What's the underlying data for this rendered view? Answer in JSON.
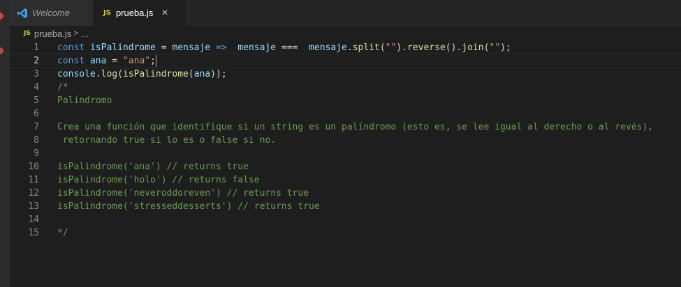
{
  "tabs": [
    {
      "label": "Welcome",
      "icon": "vscode-icon",
      "active": false
    },
    {
      "label": "prueba.js",
      "icon": "js-file-icon",
      "active": true,
      "close": "×"
    }
  ],
  "breadcrumb": {
    "file_icon_text": "JS",
    "file": "prueba.js",
    "separator": ">",
    "more": "..."
  },
  "lines": [
    {
      "num": "1",
      "tokens": [
        {
          "t": "const",
          "c": "kw"
        },
        {
          "t": " ",
          "c": "punc"
        },
        {
          "t": "isPalindrome",
          "c": "var"
        },
        {
          "t": " = ",
          "c": "punc"
        },
        {
          "t": "mensaje",
          "c": "var"
        },
        {
          "t": " ",
          "c": "punc"
        },
        {
          "t": "=>",
          "c": "kw"
        },
        {
          "t": "  ",
          "c": "punc"
        },
        {
          "t": "mensaje",
          "c": "var"
        },
        {
          "t": " ===  ",
          "c": "punc"
        },
        {
          "t": "mensaje",
          "c": "var"
        },
        {
          "t": ".",
          "c": "punc"
        },
        {
          "t": "split",
          "c": "fn"
        },
        {
          "t": "(",
          "c": "punc"
        },
        {
          "t": "\"\"",
          "c": "str"
        },
        {
          "t": ").",
          "c": "punc"
        },
        {
          "t": "reverse",
          "c": "fn"
        },
        {
          "t": "().",
          "c": "punc"
        },
        {
          "t": "join",
          "c": "fn"
        },
        {
          "t": "(",
          "c": "punc"
        },
        {
          "t": "\"\"",
          "c": "str"
        },
        {
          "t": ");",
          "c": "punc"
        }
      ]
    },
    {
      "num": "2",
      "current": true,
      "tokens": [
        {
          "t": "const",
          "c": "kw"
        },
        {
          "t": " ",
          "c": "punc"
        },
        {
          "t": "ana",
          "c": "var"
        },
        {
          "t": " = ",
          "c": "punc"
        },
        {
          "t": "\"ana\"",
          "c": "str"
        },
        {
          "t": ";",
          "c": "punc"
        }
      ]
    },
    {
      "num": "3",
      "tokens": [
        {
          "t": "console",
          "c": "var"
        },
        {
          "t": ".",
          "c": "punc"
        },
        {
          "t": "log",
          "c": "fn"
        },
        {
          "t": "(",
          "c": "punc"
        },
        {
          "t": "isPalindrome",
          "c": "fn"
        },
        {
          "t": "(",
          "c": "punc"
        },
        {
          "t": "ana",
          "c": "var"
        },
        {
          "t": "));",
          "c": "punc"
        }
      ]
    },
    {
      "num": "4",
      "tokens": [
        {
          "t": "/*",
          "c": "cm"
        }
      ]
    },
    {
      "num": "5",
      "tokens": [
        {
          "t": "Palíndromo",
          "c": "cm"
        }
      ]
    },
    {
      "num": "6",
      "tokens": []
    },
    {
      "num": "7",
      "tokens": [
        {
          "t": "Crea una función que identifique si un string es un palíndromo (esto es, se lee igual al derecho o al revés),",
          "c": "cm"
        }
      ]
    },
    {
      "num": "8",
      "tokens": [
        {
          "t": " retornando true si lo es o false si no.",
          "c": "cm"
        }
      ]
    },
    {
      "num": "9",
      "tokens": []
    },
    {
      "num": "10",
      "tokens": [
        {
          "t": "isPalindrome('ana') // returns true",
          "c": "cm"
        }
      ]
    },
    {
      "num": "11",
      "tokens": [
        {
          "t": "isPalindrome('holo') // returns false",
          "c": "cm"
        }
      ]
    },
    {
      "num": "12",
      "tokens": [
        {
          "t": "isPalindrome('neveroddoreven') // returns true",
          "c": "cm"
        }
      ]
    },
    {
      "num": "13",
      "tokens": [
        {
          "t": "isPalindrome('stresseddesserts') // returns true",
          "c": "cm"
        }
      ]
    },
    {
      "num": "14",
      "tokens": []
    },
    {
      "num": "15",
      "tokens": [
        {
          "t": "*/",
          "c": "cm"
        }
      ]
    }
  ],
  "colors": {
    "background": "#1e1e1e",
    "keyword": "#569cd6",
    "variable": "#9cdcfe",
    "function": "#dcdcaa",
    "string": "#ce9178",
    "comment": "#6a9955"
  }
}
